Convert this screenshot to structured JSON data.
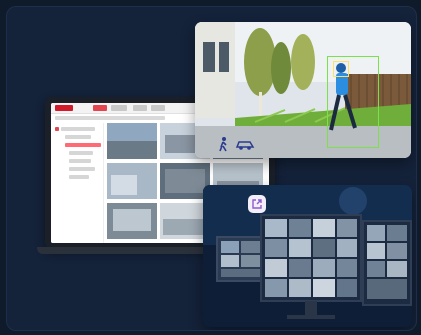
{
  "scene": {
    "background": "#0f1a2b",
    "panel": "#14223a"
  },
  "laptop_app": {
    "brand_color": "#d11b2a",
    "accent": "#e24450",
    "tree": [
      {
        "selected": false
      },
      {
        "selected": false
      },
      {
        "selected": true
      },
      {
        "selected": false
      },
      {
        "selected": false
      },
      {
        "selected": false
      },
      {
        "selected": false
      }
    ],
    "thumb_colors": [
      "#8fa7bf",
      "#c8d2dc",
      "#6e7f91",
      "#a9b8c6",
      "#5f6e7c",
      "#b8c3cc",
      "#7d8b96",
      "#cfd6dc",
      "#9aa7b3"
    ]
  },
  "camera_view": {
    "detection_color": "#7ce04b",
    "icons": [
      "person-walking-icon",
      "vehicle-icon"
    ]
  },
  "monitor_view": {
    "badge_icon": "external-link-icon"
  }
}
